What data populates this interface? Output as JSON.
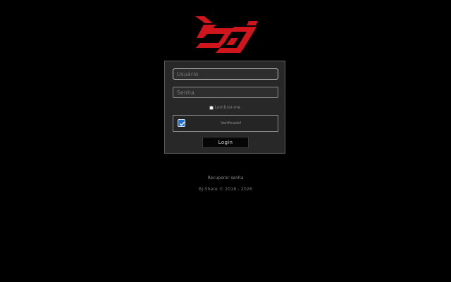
{
  "site": {
    "logo": "bj-logo",
    "brand_color": "#d0161c"
  },
  "login_form": {
    "username": {
      "placeholder": "Usuário",
      "value": ""
    },
    "password": {
      "placeholder": "Senha",
      "value": ""
    },
    "remember_label": "Lembrar-me",
    "remember_checked": false,
    "captcha": {
      "label": "Verificado!",
      "checked": true,
      "check_color": "#1a6fd9"
    },
    "submit_label": "Login"
  },
  "links": {
    "recover_password": "Recuperar senha"
  },
  "footer": {
    "text": "Bj-Share © 2016 - 2026"
  },
  "colors": {
    "background": "#000000",
    "panel": "#282828",
    "panel_border": "#5e5e5e"
  }
}
